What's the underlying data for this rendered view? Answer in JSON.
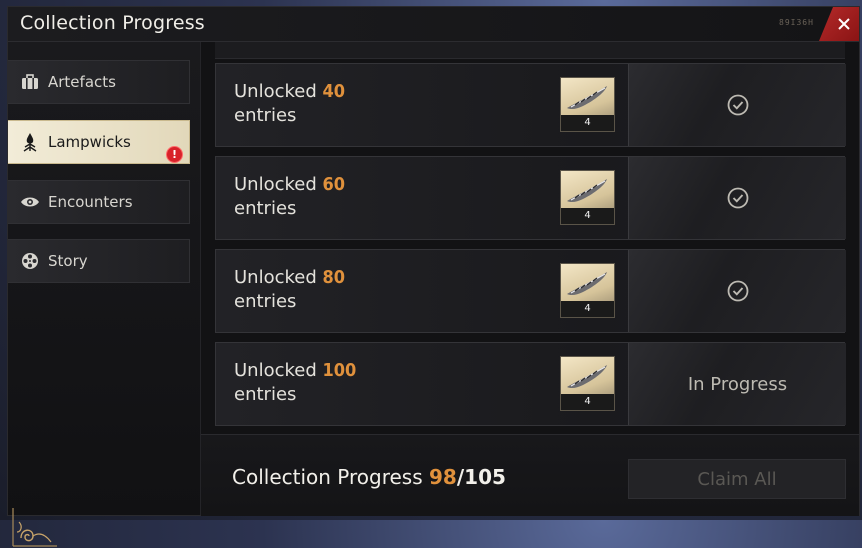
{
  "window": {
    "title": "Collection Progress",
    "watermark": "89I36H"
  },
  "sidebar": {
    "items": [
      {
        "label": "Artefacts",
        "icon": "suitcase-icon",
        "active": false
      },
      {
        "label": "Lampwicks",
        "icon": "lampwick-flame-icon",
        "active": true,
        "badge": "!"
      },
      {
        "label": "Encounters",
        "icon": "eye-lotus-icon",
        "active": false
      },
      {
        "label": "Story",
        "icon": "film-reel-icon",
        "active": false
      }
    ]
  },
  "rows": [
    {
      "prefix": "Unlocked",
      "count": "40",
      "suffix": "entries",
      "reward_qty": "4",
      "status": "claimed"
    },
    {
      "prefix": "Unlocked",
      "count": "60",
      "suffix": "entries",
      "reward_qty": "4",
      "status": "claimed"
    },
    {
      "prefix": "Unlocked",
      "count": "80",
      "suffix": "entries",
      "reward_qty": "4",
      "status": "claimed"
    },
    {
      "prefix": "Unlocked",
      "count": "100",
      "suffix": "entries",
      "reward_qty": "4",
      "status": "In Progress"
    }
  ],
  "footer": {
    "label": "Collection Progress",
    "current": "98",
    "separator": "/",
    "total": "105",
    "claim_all_label": "Claim All"
  },
  "colors": {
    "accent_orange": "#e0913c",
    "close_red": "#b52a2a",
    "active_tab": "#f2ecd8"
  }
}
